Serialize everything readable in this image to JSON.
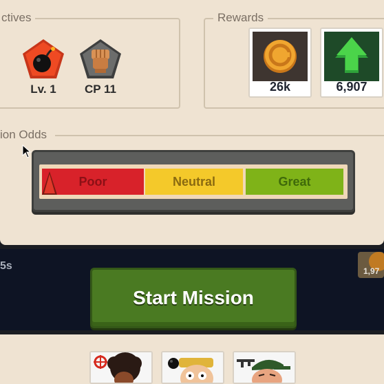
{
  "objectives": {
    "title": "ctives",
    "badges": [
      {
        "icon": "bomb-icon",
        "label": "Lv. 1",
        "color": "#e8431f"
      },
      {
        "icon": "fist-icon",
        "label": "CP 11",
        "color": "#5f6060"
      }
    ]
  },
  "rewards": {
    "title": "Rewards",
    "items": [
      {
        "icon": "coin-icon",
        "value": "26k"
      },
      {
        "icon": "up-arrow-icon",
        "value": "6,907"
      }
    ]
  },
  "odds": {
    "title": "ion Odds",
    "segments": [
      {
        "label": "Poor",
        "color": "#d8222a"
      },
      {
        "label": "Neutral",
        "color": "#f4c92a"
      },
      {
        "label": "Great",
        "color": "#7fb318"
      }
    ],
    "marker_position": "Poor"
  },
  "status": {
    "timer": "5s",
    "side_value": "1,97"
  },
  "start_button": {
    "label": "Start Mission"
  },
  "squad": [
    {
      "avatar": "soldier-afro-avatar",
      "badge": "target-icon"
    },
    {
      "avatar": "soldier-blonde-avatar",
      "badge": "bomb-icon"
    },
    {
      "avatar": "soldier-cap-avatar",
      "badge": "rifle-icon"
    }
  ]
}
